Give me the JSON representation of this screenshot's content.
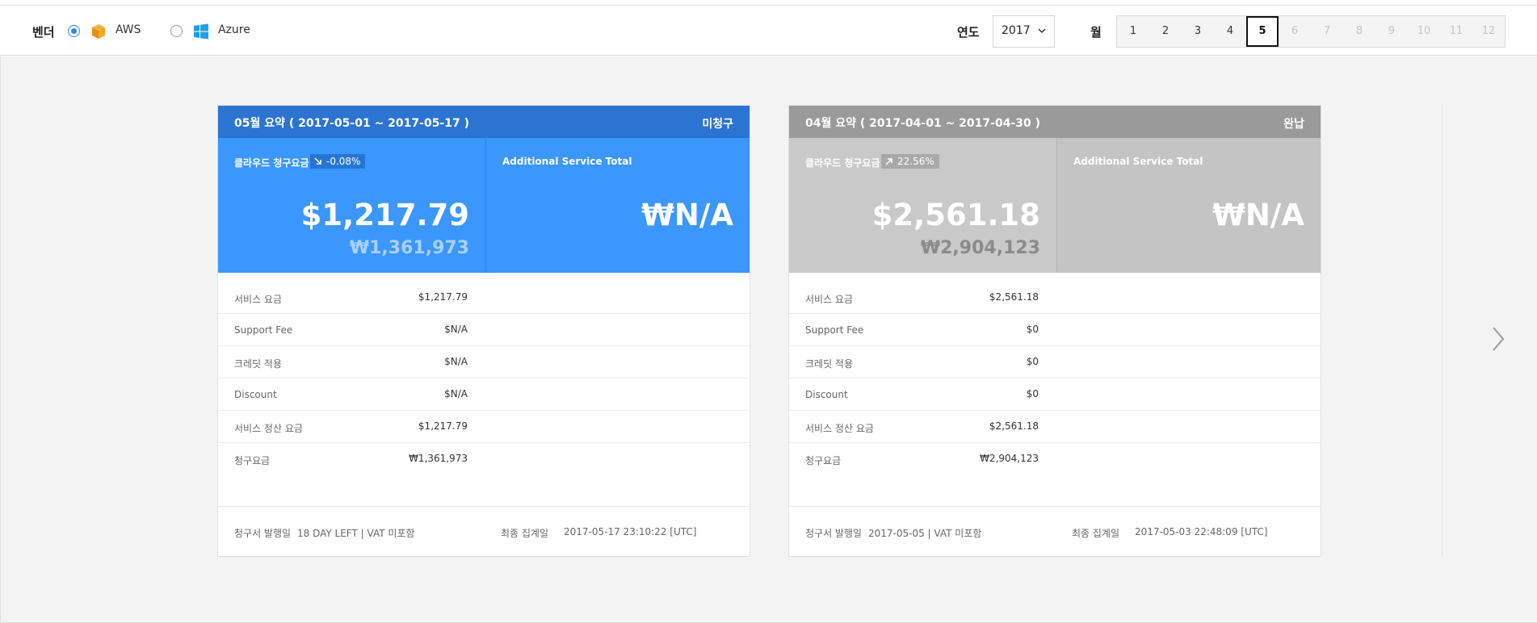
{
  "filter": {
    "vendor_label": "벤더",
    "vendors": [
      {
        "label": "AWS",
        "selected": true,
        "icon": "aws-box-icon"
      },
      {
        "label": "Azure",
        "selected": false,
        "icon": "windows-icon"
      }
    ],
    "year_label": "연도",
    "year_value": "2017",
    "month_label": "월",
    "months": [
      "1",
      "2",
      "3",
      "4",
      "5",
      "6",
      "7",
      "8",
      "9",
      "10",
      "11",
      "12"
    ],
    "active_month": "5",
    "accent_color": "#2f87f0"
  },
  "cards": [
    {
      "title": "05월 요약 ( 2017-05-01 ~ 2017-05-17 )",
      "status": "미청구",
      "cloud_caption": "클라우드 청구요금",
      "trend": "-0.08%",
      "trend_direction": "down",
      "amount_usd": "$1,217.79",
      "amount_krw": "₩1,361,973",
      "additional_caption": "Additional Service Total",
      "additional_value": "₩N/A",
      "rows": [
        {
          "label": "서비스 요금",
          "value": "$1,217.79"
        },
        {
          "label": "Support Fee",
          "value": "$N/A"
        },
        {
          "label": "크레딧 적용",
          "value": "$N/A"
        },
        {
          "label": "Discount",
          "value": "$N/A"
        },
        {
          "label": "서비스 정산 요금",
          "value": "$1,217.79"
        },
        {
          "label": "청구요금",
          "value": "₩1,361,973"
        }
      ],
      "footer": {
        "issue_label": "청구서 발행일",
        "issue_value": "18 DAY LEFT | VAT 미포함",
        "final_label": "최종 집계일",
        "final_value": "2017-05-17 23:10:22 [UTC]"
      },
      "header_color": "#2b74d2",
      "hero_color": "#3b97fc"
    },
    {
      "title": "04월 요약 ( 2017-04-01 ~ 2017-04-30 )",
      "status": "완납",
      "cloud_caption": "클라우드 청구요금",
      "trend": "22.56%",
      "trend_direction": "up",
      "amount_usd": "$2,561.18",
      "amount_krw": "₩2,904,123",
      "additional_caption": "Additional Service Total",
      "additional_value": "₩N/A",
      "rows": [
        {
          "label": "서비스 요금",
          "value": "$2,561.18"
        },
        {
          "label": "Support Fee",
          "value": "$0"
        },
        {
          "label": "크레딧 적용",
          "value": "$0"
        },
        {
          "label": "Discount",
          "value": "$0"
        },
        {
          "label": "서비스 정산 요금",
          "value": "$2,561.18"
        },
        {
          "label": "청구요금",
          "value": "₩2,904,123"
        }
      ],
      "footer": {
        "issue_label": "청구서 발행일",
        "issue_value": "2017-05-05 | VAT 미포함",
        "final_label": "최종 집계일",
        "final_value": "2017-05-03 22:48:09 [UTC]"
      },
      "header_color": "#9a9a9a",
      "hero_color": "#c9c9c9"
    }
  ],
  "nav": {
    "next_icon": "chevron-right-icon"
  }
}
